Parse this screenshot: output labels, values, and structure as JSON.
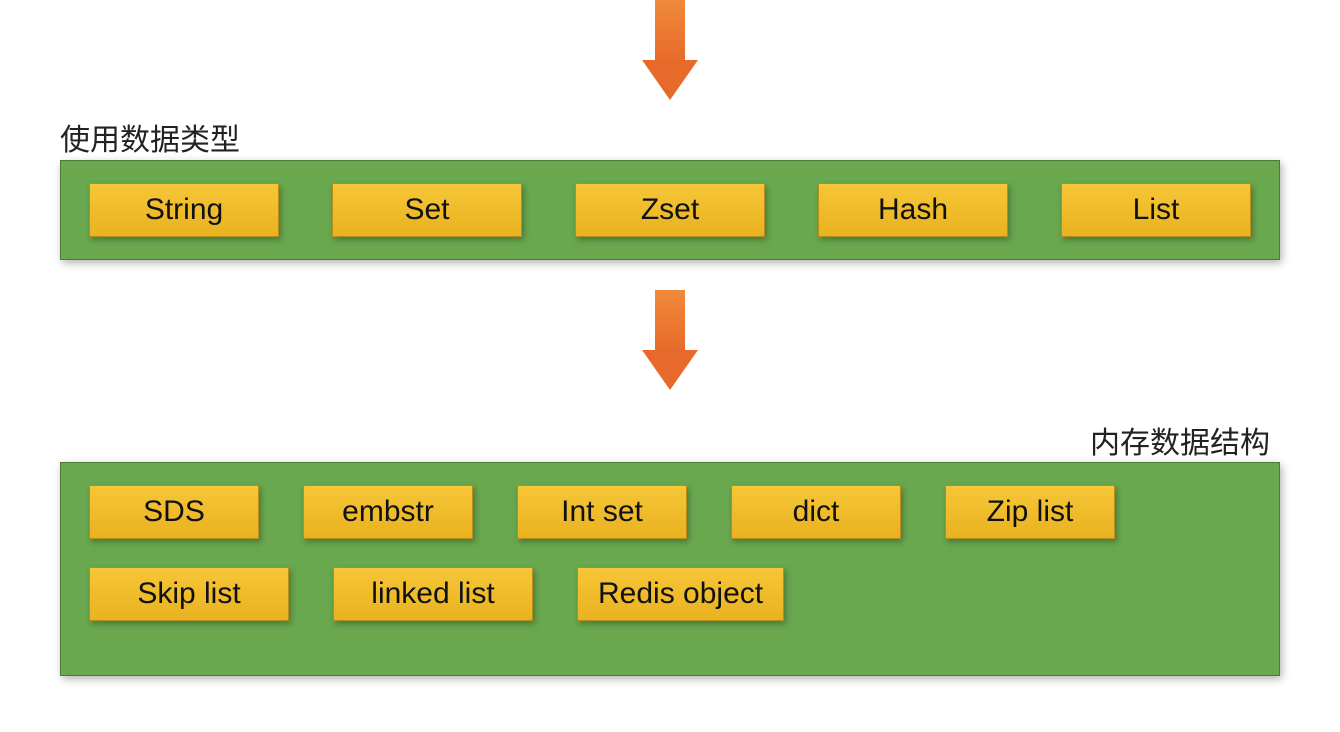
{
  "labels": {
    "top": "使用数据类型",
    "bottom": "内存数据结构"
  },
  "dataTypes": {
    "string": "String",
    "set": "Set",
    "zset": "Zset",
    "hash": "Hash",
    "list": "List"
  },
  "structures": {
    "sds": "SDS",
    "embstr": "embstr",
    "intset": "Int set",
    "dict": "dict",
    "ziplist": "Zip list",
    "skiplist": "Skip list",
    "linkedlist": "linked list",
    "redisobject": "Redis object"
  }
}
